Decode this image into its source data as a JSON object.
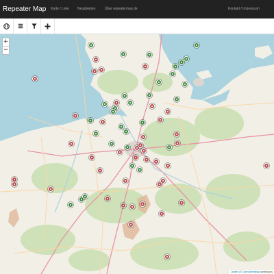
{
  "app": {
    "brand": "Repeater Map"
  },
  "nav": {
    "items": [
      {
        "label": "Karte / Liste"
      },
      {
        "label": "Neuigkeiten"
      },
      {
        "label": "Über repeatermap.de"
      }
    ],
    "right": "Kontakt / Impressum"
  },
  "toolbar": {
    "tools": [
      {
        "icon": "globe-icon"
      },
      {
        "icon": "list-icon"
      },
      {
        "icon": "filter-icon"
      },
      {
        "icon": "plus-icon"
      }
    ]
  },
  "zoom": {
    "in": "+",
    "out": "−"
  },
  "attribution": {
    "leaflet": "Leaflet",
    "sep": " | © ",
    "osm": "OpenStreetMap",
    "suffix": " contributors"
  },
  "colors": {
    "navbar": "#222222",
    "online": "#3c8a3c",
    "offline": "#b84a4a",
    "sea": "#aad3df",
    "land": "#f1efe6",
    "green": "#c8dfb0"
  },
  "markers": [
    {
      "s": "online"
    },
    {
      "s": "online"
    },
    {
      "s": "online"
    },
    {
      "s": "online"
    },
    {
      "s": "online"
    },
    {
      "s": "online"
    },
    {
      "s": "online"
    },
    {
      "s": "online"
    },
    {
      "s": "online"
    },
    {
      "s": "online"
    },
    {
      "s": "online"
    },
    {
      "s": "online"
    },
    {
      "s": "online"
    },
    {
      "s": "online"
    },
    {
      "s": "online"
    },
    {
      "s": "online"
    },
    {
      "s": "online"
    },
    {
      "s": "online"
    },
    {
      "s": "online"
    },
    {
      "s": "online"
    },
    {
      "s": "online"
    },
    {
      "s": "online"
    },
    {
      "s": "online"
    },
    {
      "s": "online"
    },
    {
      "s": "online"
    },
    {
      "s": "online"
    },
    {
      "s": "online"
    },
    {
      "s": "online"
    },
    {
      "s": "online"
    },
    {
      "s": "online"
    },
    {
      "s": "offline"
    },
    {
      "s": "offline"
    },
    {
      "s": "offline"
    },
    {
      "s": "offline"
    },
    {
      "s": "offline"
    },
    {
      "s": "offline"
    },
    {
      "s": "offline"
    },
    {
      "s": "offline"
    },
    {
      "s": "offline"
    },
    {
      "s": "offline"
    },
    {
      "s": "offline"
    },
    {
      "s": "offline"
    },
    {
      "s": "offline"
    },
    {
      "s": "offline"
    },
    {
      "s": "offline"
    },
    {
      "s": "offline"
    },
    {
      "s": "offline"
    },
    {
      "s": "offline"
    },
    {
      "s": "offline"
    },
    {
      "s": "offline"
    },
    {
      "s": "offline"
    },
    {
      "s": "offline"
    },
    {
      "s": "offline"
    },
    {
      "s": "offline"
    },
    {
      "s": "offline"
    },
    {
      "s": "offline"
    },
    {
      "s": "offline"
    },
    {
      "s": "offline"
    },
    {
      "s": "offline"
    },
    {
      "s": "offline"
    },
    {
      "s": "offline"
    },
    {
      "s": "offline"
    },
    {
      "s": "offline"
    },
    {
      "s": "offline"
    },
    {
      "s": "offline"
    },
    {
      "s": "offline"
    },
    {
      "s": "offline"
    },
    {
      "s": "offline"
    },
    {
      "s": "offline"
    },
    {
      "s": "offline"
    }
  ]
}
